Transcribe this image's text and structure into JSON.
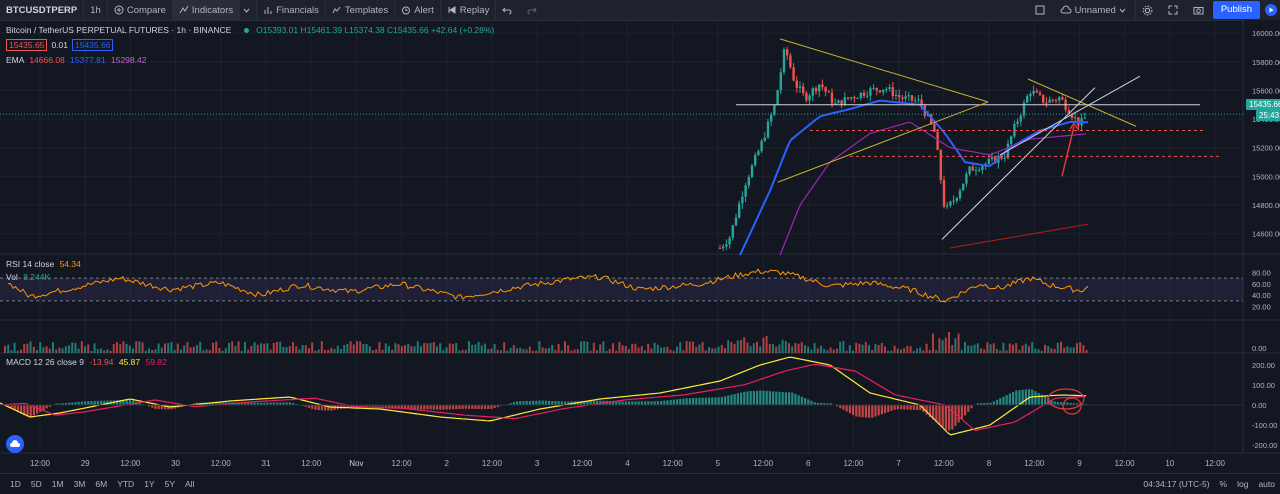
{
  "toolbar": {
    "symbol": "BTCUSDTPERP",
    "interval": "1h",
    "compare": "Compare",
    "indicators": "Indicators",
    "financials": "Financials",
    "templates": "Templates",
    "alert": "Alert",
    "replay": "Replay",
    "layout_name": "Unnamed",
    "publish": "Publish"
  },
  "legend": {
    "title": "Bitcoin / TetherUS PERPETUAL FUTURES · 1h · BINANCE",
    "ohlc": "O15393.01 H15461.39 L15374.38 C15435.66 +42.64 (+0.28%)",
    "bid": "15435.65",
    "spread": "0.01",
    "ask": "15435.66",
    "ema_label": "EMA",
    "ema_v1": "14666.08",
    "ema_v2": "15377.81",
    "ema_v3": "15298.42",
    "rsi_label": "RSI 14 close",
    "rsi_value": "54.34",
    "vol_label": "Vol",
    "vol_value": "8.244K",
    "macd_label": "MACD 12 26 close 9",
    "macd_v1": "-13.94",
    "macd_v2": "45.87",
    "macd_v3": "59.82"
  },
  "price_axis": {
    "ticks": [
      "16000.00",
      "15800.00",
      "15600.00",
      "15400.00",
      "15200.00",
      "15000.00",
      "14800.00",
      "14600.00"
    ],
    "current_price": "15435.66",
    "countdown": "25:43"
  },
  "rsi_axis": {
    "ticks": [
      "80.00",
      "60.00",
      "40.00",
      "20.00"
    ]
  },
  "vol_axis": {
    "ticks": [
      "0.00"
    ]
  },
  "macd_axis": {
    "ticks": [
      "200.00",
      "100.00",
      "0.00",
      "-100.00",
      "-200.00"
    ]
  },
  "time_axis": {
    "labels": [
      "12:00",
      "29",
      "12:00",
      "30",
      "12:00",
      "31",
      "12:00",
      "Nov",
      "12:00",
      "2",
      "12:00",
      "3",
      "12:00",
      "4",
      "12:00",
      "5",
      "12:00",
      "6",
      "12:00",
      "7",
      "12:00",
      "8",
      "12:00",
      "9",
      "12:00",
      "10",
      "12:00"
    ]
  },
  "bottom": {
    "ranges": [
      "1D",
      "5D",
      "1M",
      "3M",
      "6M",
      "YTD",
      "1Y",
      "5Y",
      "All"
    ],
    "clock": "04:34:17 (UTC-5)",
    "percent": "%",
    "log": "log",
    "auto": "auto"
  },
  "colors": {
    "up": "#26a69a",
    "down": "#ef5350",
    "ema_fast": "#2962ff",
    "ema_mid": "#9c27b0",
    "ema_slow": "#b71c1c",
    "rsi": "#ff9800",
    "macd": "#ffeb3b",
    "signal": "#e91e63"
  }
}
